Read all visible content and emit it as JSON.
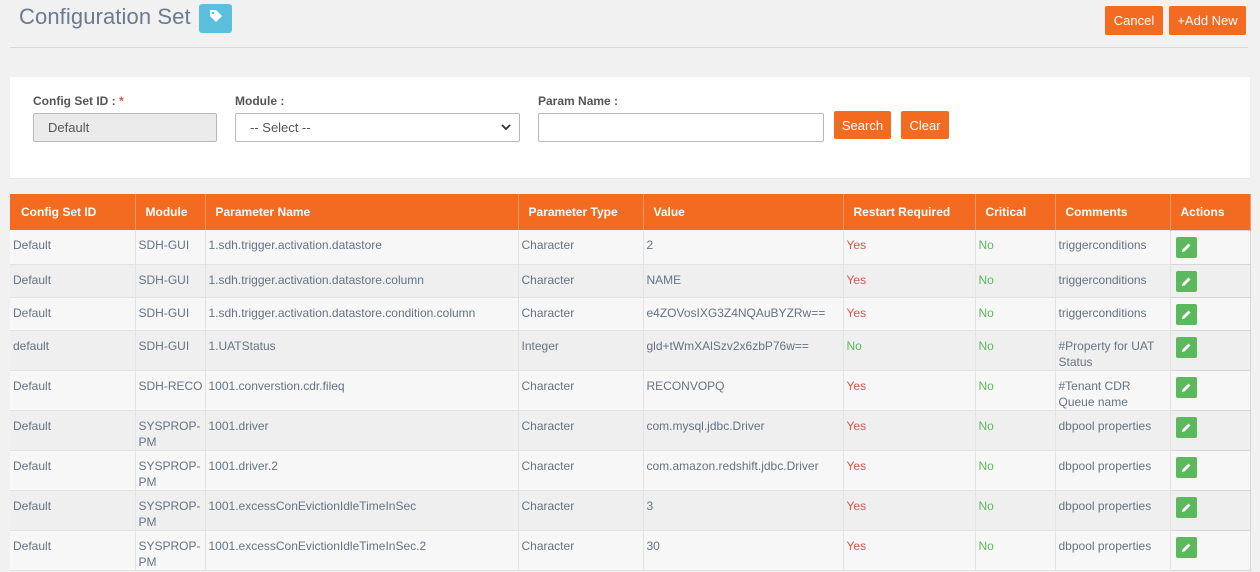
{
  "page": {
    "title": "Configuration Set",
    "cancel_label": "Cancel",
    "add_new_label": "+Add New"
  },
  "filters": {
    "config_set_id_label": "Config Set ID :",
    "required_mark": "*",
    "config_set_id_value": "Default",
    "module_label": "Module :",
    "module_selected": "-- Select --",
    "param_name_label": "Param Name :",
    "param_name_value": "",
    "search_label": "Search",
    "clear_label": "Clear"
  },
  "table": {
    "columns": [
      "Config Set ID",
      "Module",
      "Parameter Name",
      "Parameter Type",
      "Value",
      "Restart Required",
      "Critical",
      "Comments",
      "Actions"
    ],
    "rows": [
      [
        "Default",
        "SDH-GUI",
        "1.sdh.trigger.activation.datastore",
        "Character",
        "2",
        "Yes",
        "No",
        "triggerconditions"
      ],
      [
        "Default",
        "SDH-GUI",
        "1.sdh.trigger.activation.datastore.column",
        "Character",
        "NAME",
        "Yes",
        "No",
        "triggerconditions"
      ],
      [
        "Default",
        "SDH-GUI",
        "1.sdh.trigger.activation.datastore.condition.column",
        "Character",
        "e4ZOVosIXG3Z4NQAuBYZRw==",
        "Yes",
        "No",
        "triggerconditions"
      ],
      [
        "default",
        "SDH-GUI",
        "1.UATStatus",
        "Integer",
        "gld+tWmXAlSzv2x6zbP76w==",
        "No",
        "No",
        "#Property for UAT Status"
      ],
      [
        "Default",
        "SDH-RECO",
        "1001.converstion.cdr.fileq",
        "Character",
        "RECONVOPQ",
        "Yes",
        "No",
        "#Tenant CDR Queue name"
      ],
      [
        "Default",
        "SYSPROP-PM",
        "1001.driver",
        "Character",
        "com.mysql.jdbc.Driver",
        "Yes",
        "No",
        "dbpool properties"
      ],
      [
        "Default",
        "SYSPROP-PM",
        "1001.driver.2",
        "Character",
        "com.amazon.redshift.jdbc.Driver",
        "Yes",
        "No",
        "dbpool properties"
      ],
      [
        "Default",
        "SYSPROP-PM",
        "1001.excessConEvictionIdleTimeInSec",
        "Character",
        "3",
        "Yes",
        "No",
        "dbpool properties"
      ],
      [
        "Default",
        "SYSPROP-PM",
        "1001.excessConEvictionIdleTimeInSec.2",
        "Character",
        "30",
        "Yes",
        "No",
        "dbpool properties"
      ]
    ]
  },
  "colors": {
    "accent": "#f26b21",
    "tag_button": "#5bc0de",
    "edit_button": "#5cb85c",
    "yes_text": "#d9534f",
    "no_text": "#5cb85c"
  },
  "icons": {
    "tag": "tag-icon",
    "edit": "pencil-icon",
    "dropdown": "chevron-down-icon"
  }
}
